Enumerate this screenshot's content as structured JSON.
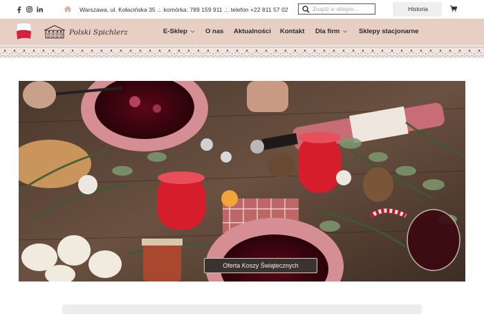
{
  "topbar": {
    "social_icons": [
      "facebook-icon",
      "instagram-icon",
      "linkedin-icon"
    ],
    "address": "Warszawa, ul. Kołacińska 35 .:. komórka:  789 159 911 .:. telefon  +22 811 57 02",
    "search_placeholder": "Znajdź w sklepie...",
    "history_label": "Historia zamówień",
    "cart_icon": "cart-icon"
  },
  "brand": {
    "name": "Polski Spichlerz",
    "flag_colors": [
      "#ffffff",
      "#d4213d"
    ]
  },
  "nav": {
    "items": [
      {
        "label": "E-Sklep",
        "has_dropdown": true
      },
      {
        "label": "O nas",
        "has_dropdown": false
      },
      {
        "label": "Aktualności",
        "has_dropdown": false
      },
      {
        "label": "Kontakt",
        "has_dropdown": false
      },
      {
        "label": "Dla firm",
        "has_dropdown": true
      },
      {
        "label": "Sklepy stacjonarne",
        "has_dropdown": false
      }
    ]
  },
  "hero": {
    "button_label": "Oferta Koszy Świątecznych"
  },
  "colors": {
    "nav_bg": "#e8cfc4",
    "strip_bg": "#ece7e3",
    "accent_red": "#c8102e",
    "button_bg": "#3b3330"
  }
}
